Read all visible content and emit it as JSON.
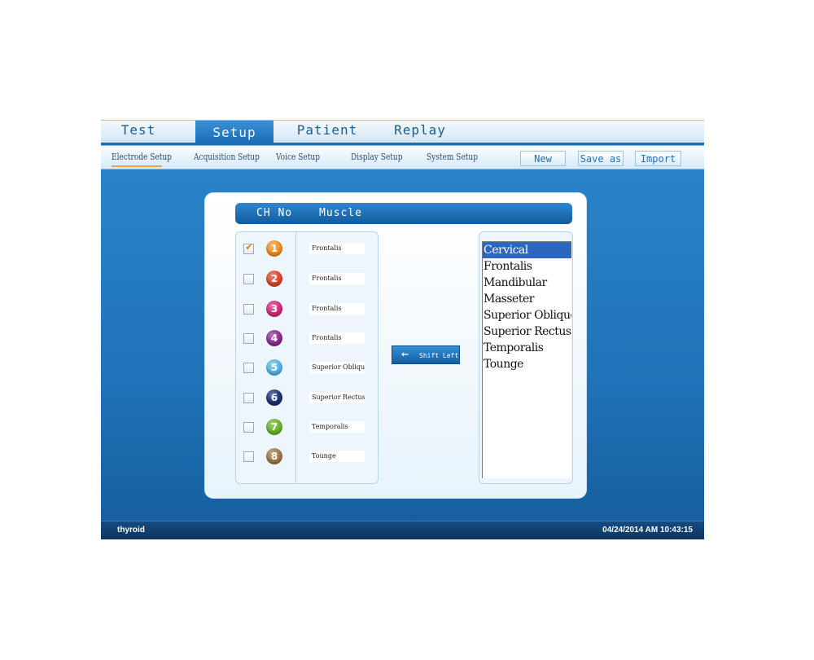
{
  "main_tabs": [
    {
      "label": "Test",
      "active": false
    },
    {
      "label": "Setup",
      "active": true
    },
    {
      "label": "Patient",
      "active": false
    },
    {
      "label": "Replay",
      "active": false
    }
  ],
  "sub_tabs": [
    {
      "label": "Electrode Setup",
      "active": true
    },
    {
      "label": "Acquisition Setup",
      "active": false
    },
    {
      "label": "Voice  Setup",
      "active": false
    },
    {
      "label": "Display Setup",
      "active": false
    },
    {
      "label": "System Setup",
      "active": false
    }
  ],
  "toolbar": {
    "new_label": "New",
    "save_as_label": "Save as",
    "import_label": "Import"
  },
  "table_header": {
    "ch_no": "CH No",
    "muscle": "Muscle"
  },
  "channels": [
    {
      "number": "1",
      "checked": true,
      "muscle": "Frontalis",
      "color": "#f0901e"
    },
    {
      "number": "2",
      "checked": false,
      "muscle": "Frontalis",
      "color": "#e2452a"
    },
    {
      "number": "3",
      "checked": false,
      "muscle": "Frontalis",
      "color": "#d6287a"
    },
    {
      "number": "4",
      "checked": false,
      "muscle": "Frontalis",
      "color": "#8d2a93"
    },
    {
      "number": "5",
      "checked": false,
      "muscle": "Superior Oblique",
      "color": "#56b3e8"
    },
    {
      "number": "6",
      "checked": false,
      "muscle": "Superior Rectus",
      "color": "#1d2f7a"
    },
    {
      "number": "7",
      "checked": false,
      "muscle": "Temporalis",
      "color": "#6bb52a"
    },
    {
      "number": "8",
      "checked": false,
      "muscle": "Tounge",
      "color": "#a07846"
    }
  ],
  "shift_left_label": "Shift Left",
  "muscle_list": [
    {
      "label": "Cervical",
      "selected": true
    },
    {
      "label": "Frontalis",
      "selected": false
    },
    {
      "label": "Mandibular",
      "selected": false
    },
    {
      "label": "Masseter",
      "selected": false
    },
    {
      "label": "Superior Oblique",
      "selected": false
    },
    {
      "label": "Superior Rectus",
      "selected": false
    },
    {
      "label": "Temporalis",
      "selected": false
    },
    {
      "label": "Tounge",
      "selected": false
    }
  ],
  "status": {
    "left": "thyroid",
    "datetime": "04/24/2014 AM 10:43:15"
  }
}
